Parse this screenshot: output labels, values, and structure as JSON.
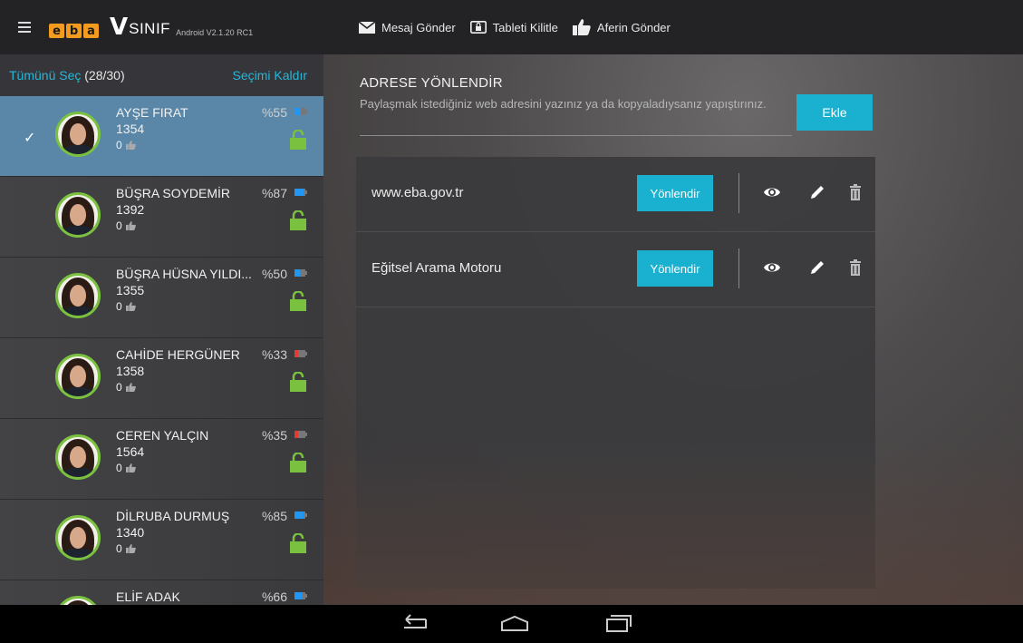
{
  "topbar": {
    "logo_letters": [
      "e",
      "b",
      "a"
    ],
    "brand_v": "V",
    "brand_name": "SINIF",
    "version": "Android V2.1.20 RC1",
    "actions": [
      {
        "label": "Mesaj Gönder",
        "icon": "envelope-icon"
      },
      {
        "label": "Tableti Kilitle",
        "icon": "tablet-lock-icon"
      },
      {
        "label": "Aferin Gönder",
        "icon": "thumbs-up-icon"
      }
    ]
  },
  "sidebar": {
    "select_all": "Tümünü Seç",
    "count": "(28/30)",
    "clear_selection": "Seçimi Kaldır",
    "students": [
      {
        "name": "AYŞE FIRAT",
        "number": "1354",
        "likes": "0",
        "battery": "%55",
        "battery_level": 0.55,
        "battery_color": "#2196f3",
        "selected": true
      },
      {
        "name": "BÜŞRA SOYDEMİR",
        "number": "1392",
        "likes": "0",
        "battery": "%87",
        "battery_level": 0.87,
        "battery_color": "#2196f3",
        "selected": false
      },
      {
        "name": "BÜŞRA HÜSNA YILDI...",
        "number": "1355",
        "likes": "0",
        "battery": "%50",
        "battery_level": 0.5,
        "battery_color": "#2196f3",
        "selected": false
      },
      {
        "name": "CAHİDE HERGÜNER",
        "number": "1358",
        "likes": "0",
        "battery": "%33",
        "battery_level": 0.33,
        "battery_color": "#e53935",
        "selected": false
      },
      {
        "name": "CEREN YALÇIN",
        "number": "1564",
        "likes": "0",
        "battery": "%35",
        "battery_level": 0.35,
        "battery_color": "#e53935",
        "selected": false
      },
      {
        "name": "DİLRUBA DURMUŞ",
        "number": "1340",
        "likes": "0",
        "battery": "%85",
        "battery_level": 0.85,
        "battery_color": "#2196f3",
        "selected": false
      },
      {
        "name": "ELİF ADAK",
        "number": "",
        "likes": "",
        "battery": "%66",
        "battery_level": 0.66,
        "battery_color": "#2196f3",
        "selected": false
      }
    ]
  },
  "main": {
    "section_title": "ADRESE YÖNLENDİR",
    "url_placeholder": "Paylaşmak istediğiniz web adresini yazınız ya da kopyaladıysanız yapıştırınız.",
    "add_label": "Ekle",
    "links": [
      {
        "title": "www.eba.gov.tr",
        "go_label": "Yönlendir"
      },
      {
        "title": "Eğitsel Arama Motoru",
        "go_label": "Yönlendir"
      }
    ]
  },
  "colors": {
    "accent": "#1ab0cf",
    "lock": "#79c13f",
    "selected_row": "#5a87a8"
  },
  "navbar": {
    "icons": [
      "back-icon",
      "home-icon",
      "recents-icon"
    ]
  }
}
